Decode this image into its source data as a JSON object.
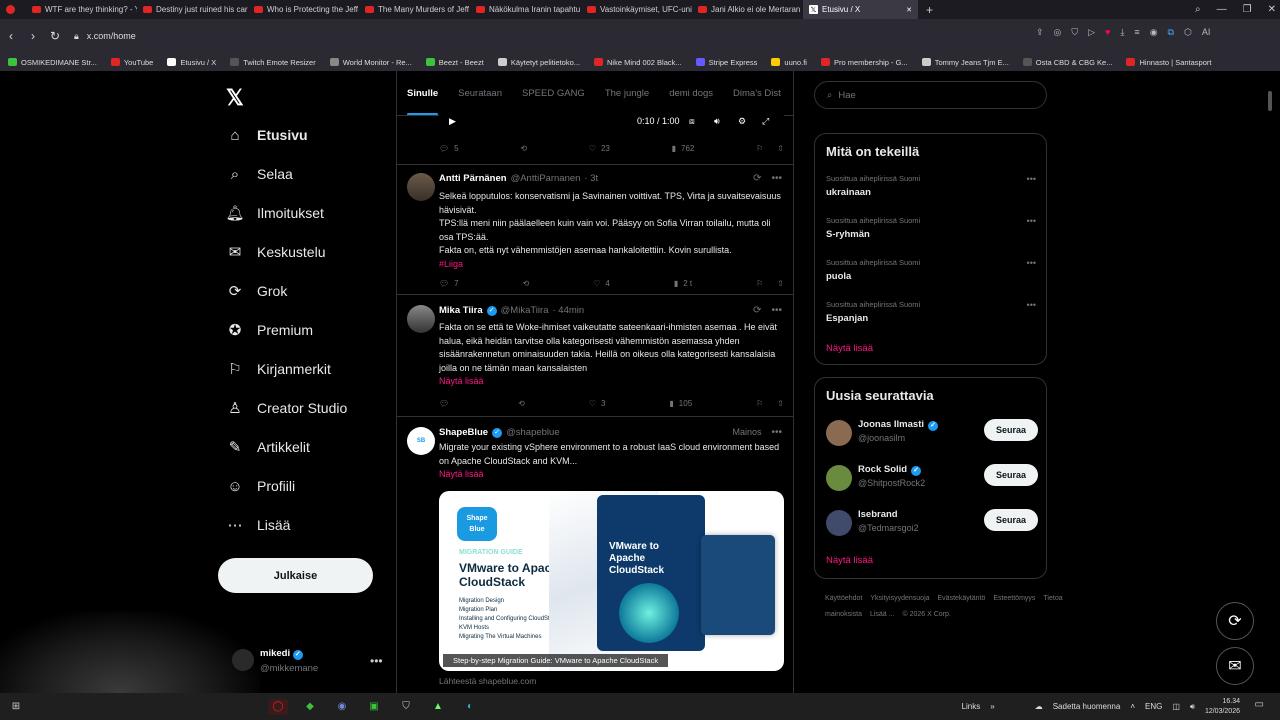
{
  "browser": {
    "tabs": [
      {
        "title": "WTF are they thinking? - Y",
        "color": "#e02525"
      },
      {
        "title": "Destiny just ruined his car",
        "color": "#e02525"
      },
      {
        "title": "Who is Protecting the Jeff",
        "color": "#e02525"
      },
      {
        "title": "The Many Murders of Jeff",
        "color": "#e02525"
      },
      {
        "title": "Näkökulma Iranin tapahtu",
        "color": "#e02525"
      },
      {
        "title": "Vastoinkäymiset, UFC-uni",
        "color": "#e02525"
      },
      {
        "title": "Jani Alkio ei ole Mertaran",
        "color": "#e02525"
      },
      {
        "title": "Etusivu / X",
        "color": "#ffffff",
        "active": true
      }
    ],
    "url": "x.com/home",
    "bookmarks": [
      {
        "label": "OSMIKEDIMANE Str...",
        "color": "#3bc43b"
      },
      {
        "label": "YouTube",
        "color": "#e02525"
      },
      {
        "label": "Etusivu / X",
        "color": "#ffffff"
      },
      {
        "label": "Twitch Emote Resizer",
        "color": "#555"
      },
      {
        "label": "World Monitor - Re...",
        "color": "#888"
      },
      {
        "label": "Beezt - Beezt",
        "color": "#3bc43b"
      },
      {
        "label": "Käytetyt pelitietoko...",
        "color": "#ccc"
      },
      {
        "label": "Nike Mind 002 Black...",
        "color": "#e02525"
      },
      {
        "label": "Stripe Express",
        "color": "#635bff"
      },
      {
        "label": "uuno.fi",
        "color": "#ffcc00"
      },
      {
        "label": "Pro membership - G...",
        "color": "#e02525"
      },
      {
        "label": "Tommy Jeans Tjm E...",
        "color": "#ccc"
      },
      {
        "label": "Osta CBD & CBG Ke...",
        "color": "#555"
      },
      {
        "label": "Hinnasto | Santasport",
        "color": "#e02525"
      }
    ]
  },
  "nav": {
    "logo": "𝕏",
    "items": [
      {
        "label": "Etusivu",
        "icon": "home-icon"
      },
      {
        "label": "Selaa",
        "icon": "search-icon"
      },
      {
        "label": "Ilmoitukset",
        "icon": "bell-icon"
      },
      {
        "label": "Keskustelu",
        "icon": "mail-icon"
      },
      {
        "label": "Grok",
        "icon": "grok-icon"
      },
      {
        "label": "Premium",
        "icon": "premium-icon"
      },
      {
        "label": "Kirjanmerkit",
        "icon": "bookmark-icon"
      },
      {
        "label": "Creator Studio",
        "icon": "creator-icon"
      },
      {
        "label": "Artikkelit",
        "icon": "articles-icon"
      },
      {
        "label": "Profiili",
        "icon": "profile-icon"
      },
      {
        "label": "Lisää",
        "icon": "more-icon"
      }
    ],
    "post_label": "Julkaise",
    "account_name": "mikedi",
    "account_handle": "@mikkemane"
  },
  "feed": {
    "tabs": [
      "Sinulle",
      "Seurataan",
      "SPEED GANG",
      "The jungle",
      "demi dogs",
      "Dima's Dist"
    ],
    "video": {
      "time": "0:10 / 1:00"
    },
    "first_actions": {
      "replies": "5",
      "likes": "23",
      "views": "762"
    },
    "tweets": [
      {
        "name": "Antti Pärnänen",
        "handle": "@AnttiParnanen",
        "time": "· 3t",
        "lines": [
          "Selkeä lopputulos: konservatismi ja Savinainen voittivat. TPS, Virta ja suvaitsevaisuus hävisivät.",
          "TPS:llä meni niin päälaelleen kuin vain voi. Pääsyy on Sofia Virran toilailu, mutta oli osa TPS:ää.",
          "Fakta on, että nyt vähemmistöjen asemaa hankaloitettiin. Kovin surullista."
        ],
        "hashtag": "#Liiga",
        "replies": "7",
        "likes": "4",
        "views": "2 t"
      },
      {
        "name": "Mika Tiira",
        "handle": "@MikaTiira",
        "time": "· 44min",
        "text": "Fakta on se että te Woke-ihmiset vaikeutatte sateenkaari-ihmisten asemaa . He eivät halua, eikä heidän tarvitse olla kategorisesti vähemmistön asemassa yhden sisäänrakennetun ominaisuuden takia. Heillä on oikeus olla kategorisesti kansalaisia joilla on ne tämän maan kansalaisten",
        "show_more": "Näytä lisää",
        "replies": "",
        "likes": "3",
        "views": "105"
      },
      {
        "name": "ShapeBlue",
        "handle": "@shapeblue",
        "ad_label": "Mainos",
        "text": "Migrate your existing vSphere environment to a robust IaaS cloud environment based on Apache CloudStack and KVM...",
        "show_more": "Näytä lisää",
        "image_caption": "Step-by-step Migration Guide: VMware to Apache CloudStack",
        "source": "Lähteestä shapeblue.com",
        "ad_image": {
          "logo_top": "Shape",
          "logo_bottom": "Blue",
          "guide_label": "MIGRATION GUIDE",
          "headline": "VMware to Apache CloudStack",
          "bullets": [
            "Migration Design",
            "Migration Plan",
            "Installing and Configuring CloudStack, Configuring KVM Hosts",
            "Migrating The Virtual Machines"
          ],
          "book_title": "VMware to Apache CloudStack"
        }
      }
    ]
  },
  "sidebar": {
    "search_placeholder": "Hae",
    "trends_title": "Mitä on tekeillä",
    "trends": [
      {
        "context": "Suosittua aiheplirissä Suomi",
        "topic": "ukrainaan"
      },
      {
        "context": "Suosittua aiheplirissä Suomi",
        "topic": "S-ryhmän"
      },
      {
        "context": "Suosittua aiheplirissä Suomi",
        "topic": "puola"
      },
      {
        "context": "Suosittua aiheplirissä Suomi",
        "topic": "Espanjan"
      }
    ],
    "show_more": "Näytä lisää",
    "follow_title": "Uusia seurattavia",
    "follow": [
      {
        "name": "Joonas Ilmasti",
        "handle": "@joonasilm",
        "verified": true,
        "color": "#8a6a50"
      },
      {
        "name": "Rock Solid",
        "handle": "@ShitpostRock2",
        "verified": true,
        "color": "#6a8a40"
      },
      {
        "name": "Isebrand",
        "handle": "@Tedmarsgoi2",
        "verified": false,
        "color": "#404a6a"
      }
    ],
    "follow_label": "Seuraa",
    "follow_show_more": "Näytä lisää",
    "footer": [
      "Käyttöehdot",
      "Yksityisyydensuoja",
      "Evästekäytäntö",
      "Esteettömyys",
      "Tietoa mainoksista",
      "Lisää ...",
      "© 2026 X Corp."
    ]
  },
  "taskbar": {
    "links": "Links",
    "weather": "Sadetta huomenna",
    "lang": "ENG",
    "time": "16.34",
    "date": "12/03/2026"
  }
}
